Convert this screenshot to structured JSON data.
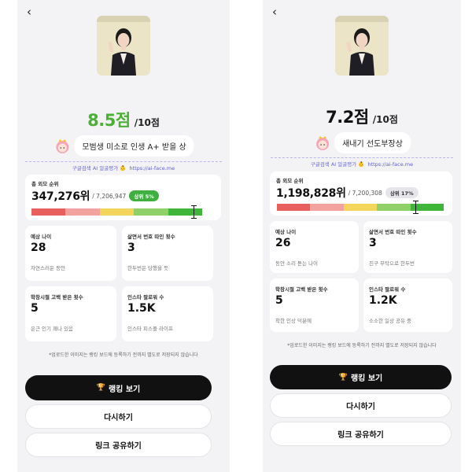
{
  "left": {
    "score": "8.5점",
    "score_suffix": "/10점",
    "score_color": "#4caf36",
    "comment": "모범생 미소로 인생 A+ 받을 상",
    "source_label": "구글검색 AI 얼굴평가",
    "source_url": "https://ai-face.me",
    "rank_label": "총 외모 순위",
    "rank_value": "347,276위",
    "rank_total": "/ 7,206,947",
    "rank_badge": "상위 5%",
    "rank_percent": 5,
    "badge_bg": "#3fb03f",
    "badge_color": "#ffffff",
    "stats": [
      {
        "label": "예상 나이",
        "value": "28",
        "desc": "자연스러운 동안"
      },
      {
        "label": "삶면서 번호 따인 횟수",
        "value": "3",
        "desc": "한두번은 당했을 듯"
      },
      {
        "label": "학창시절 고백 받은 횟수",
        "value": "5",
        "desc": "은근 인기 꽤나 있음"
      },
      {
        "label": "인스타 팔로워 수",
        "value": "1.5K",
        "desc": "인스타 피스플 라이프"
      }
    ],
    "disclaimer": "*업로드한 이미지는 랭킹 보드에 등록하기 전까지 별도로 저장되지 않습니다",
    "buttons": {
      "ranking": "랭킹 보기",
      "retry": "다시하기",
      "share": "링크 공유하기"
    }
  },
  "right": {
    "score": "7.2점",
    "score_suffix": "/10점",
    "score_color": "#111111",
    "comment": "새내기 선도부장상",
    "source_label": "구글검색 AI 얼굴평가",
    "source_url": "https://ai-face.me",
    "rank_label": "총 외모 순위",
    "rank_value": "1,198,828위",
    "rank_total": "/ 7,200,308",
    "rank_badge": "상위 17%",
    "rank_percent": 17,
    "badge_bg": "#e6e6ea",
    "badge_color": "#333333",
    "stats": [
      {
        "label": "예상 나이",
        "value": "26",
        "desc": "동안 소리 듣는 나이"
      },
      {
        "label": "삶면서 번호 따인 횟수",
        "value": "3",
        "desc": "친구 부탁으로 한두번"
      },
      {
        "label": "학창시절 고백 받은 횟수",
        "value": "5",
        "desc": "착한 인상 덕분에"
      },
      {
        "label": "인스타 팔로워 수",
        "value": "1.2K",
        "desc": "소소한 일상 공유 중"
      }
    ],
    "disclaimer": "*업로드한 이미지는 랭킹 보드에 등록하기 전까지 별도로 저장되지 않습니다",
    "buttons": {
      "ranking": "랭킹 보기",
      "retry": "다시하기",
      "share": "링크 공유하기"
    }
  },
  "gauge_colors": [
    "#e8605e",
    "#f2a3a0",
    "#f4d55c",
    "#8fd068",
    "#3fb53a"
  ],
  "icons": {
    "back": "chevron-left-icon",
    "trophy": "trophy-icon",
    "avatar": "princess-avatar-icon",
    "source": "baby-icon"
  }
}
